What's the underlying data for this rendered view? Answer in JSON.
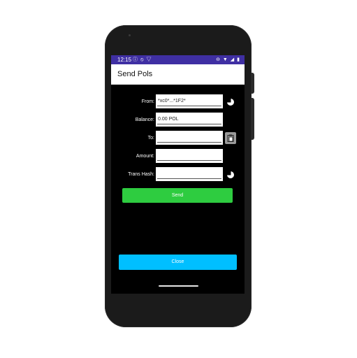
{
  "statusbar": {
    "time": "12:15",
    "left_icons": "ⓘ ⦸ ▽",
    "right_icons": "⊖ ▼ ◢ ▮"
  },
  "app": {
    "title": "Send Pols"
  },
  "form": {
    "from": {
      "label": "From:",
      "value": "*xc0*...*1F2*"
    },
    "balance": {
      "label": "Balance:",
      "value": "0.00 POL"
    },
    "to": {
      "label": "To:",
      "value": ""
    },
    "amount": {
      "label": "Amount:",
      "value": ""
    },
    "trans_hash": {
      "label": "Trans Hash:",
      "value": ""
    }
  },
  "buttons": {
    "send": "Send",
    "close": "Close"
  },
  "colors": {
    "status_bar": "#3f2fa3",
    "send": "#2ecc40",
    "close": "#00bfff"
  },
  "icons": [
    "copy-icon",
    "paste-icon"
  ]
}
